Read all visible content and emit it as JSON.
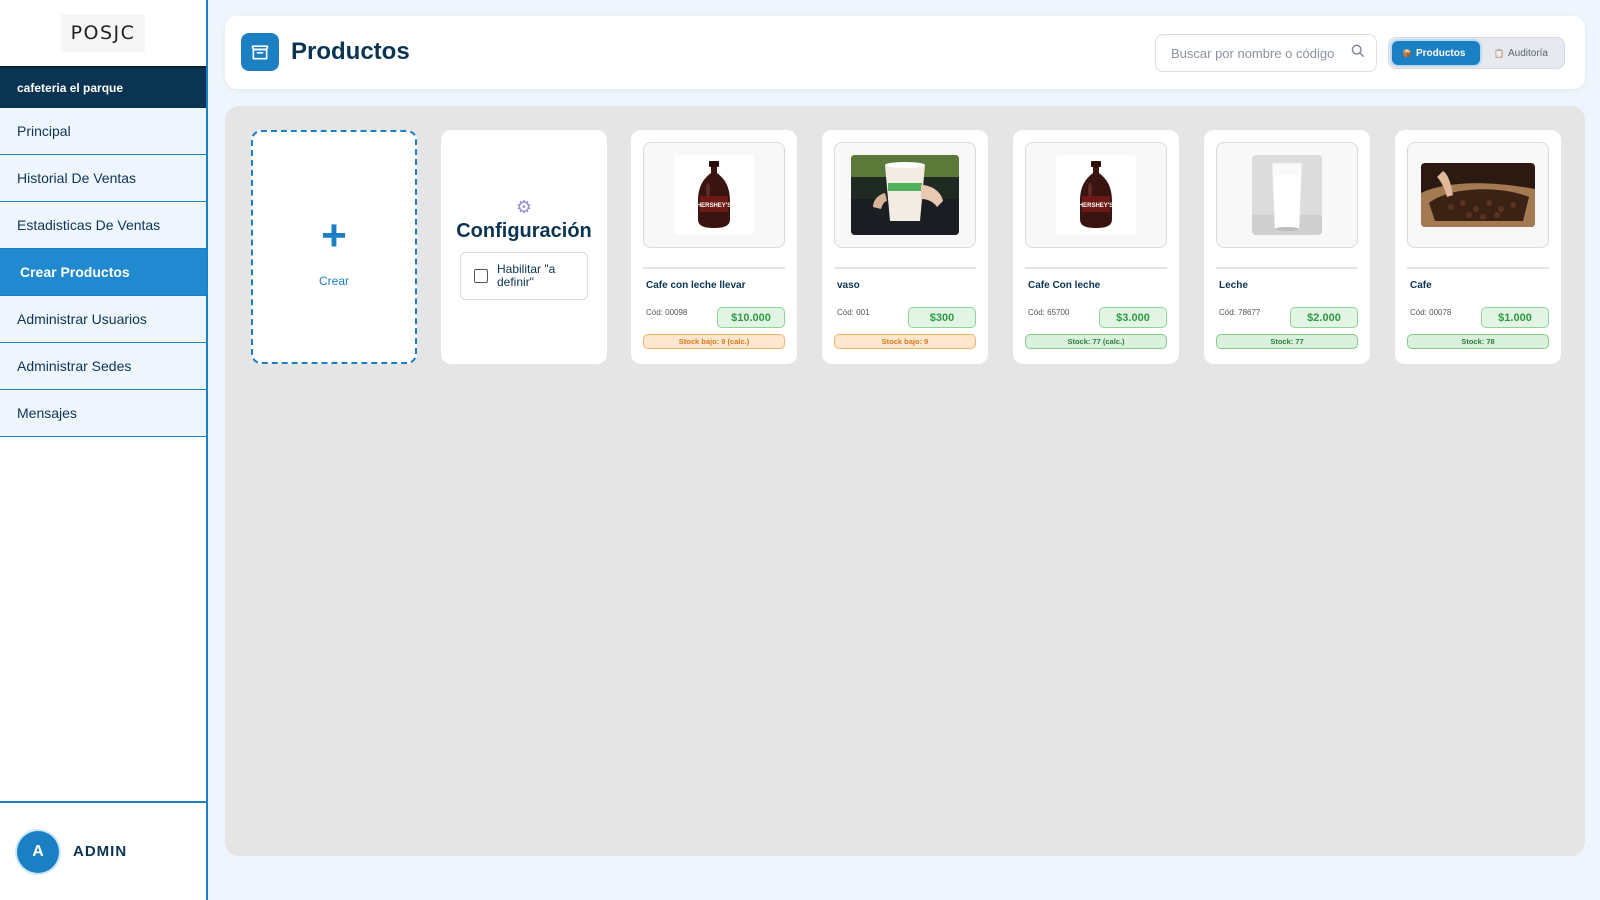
{
  "app": {
    "logo": "POSJC",
    "store": "cafeteria el parque"
  },
  "sidebar": {
    "items": [
      {
        "label": "Principal",
        "active": false
      },
      {
        "label": "Historial De Ventas",
        "active": false
      },
      {
        "label": "Estadisticas De Ventas",
        "active": false
      },
      {
        "label": "Crear Productos",
        "active": true
      },
      {
        "label": "Administrar Usuarios",
        "active": false
      },
      {
        "label": "Administrar Sedes",
        "active": false
      },
      {
        "label": "Mensajes",
        "active": false
      }
    ]
  },
  "user": {
    "initial": "A",
    "name": "ADMIN"
  },
  "header": {
    "title": "Productos",
    "title_icon": "store-icon",
    "search_placeholder": "Buscar por nombre o código",
    "tabs": [
      {
        "label": "Productos",
        "icon": "box-icon",
        "active": true
      },
      {
        "label": "Auditoría",
        "icon": "clipboard-icon",
        "active": false
      }
    ]
  },
  "create": {
    "label": "Crear",
    "icon": "plus-icon"
  },
  "config": {
    "title": "Configuración",
    "icon": "gear-icon",
    "checkbox_label": "Habilitar \"a definir\"",
    "checked": false
  },
  "products": [
    {
      "name": "Cafe con leche llevar",
      "code": "Cód: 00098",
      "price": "$10.000",
      "stock": "Stock bajo: 9 (calc.)",
      "stock_status": "low",
      "image": "chocolate-syrup-bottle"
    },
    {
      "name": "vaso",
      "code": "Cód: 001",
      "price": "$300",
      "stock": "Stock bajo: 9",
      "stock_status": "low",
      "image": "paper-cup-photo"
    },
    {
      "name": "Cafe Con leche",
      "code": "Cód: 65700",
      "price": "$3.000",
      "stock": "Stock: 77 (calc.)",
      "stock_status": "ok",
      "image": "chocolate-syrup-bottle"
    },
    {
      "name": "Leche",
      "code": "Cód: 78677",
      "price": "$2.000",
      "stock": "Stock: 77",
      "stock_status": "ok",
      "image": "glass-of-milk"
    },
    {
      "name": "Cafe",
      "code": "Cód: 00078",
      "price": "$1.000",
      "stock": "Stock: 78",
      "stock_status": "ok",
      "image": "coffee-beans-sack"
    }
  ],
  "colors": {
    "primary": "#1b7fc4",
    "navy": "#0b3452",
    "low_stock": "#d9781c",
    "ok_stock": "#2e7d3e",
    "price": "#2e9a44"
  }
}
